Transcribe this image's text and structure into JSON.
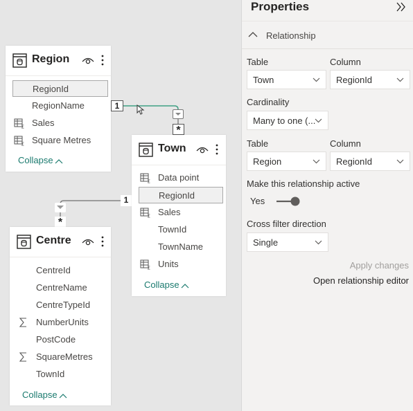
{
  "diagram": {
    "tables": [
      {
        "name": "Region",
        "fields": [
          {
            "label": "RegionId",
            "icon": "none",
            "selected": true
          },
          {
            "label": "RegionName",
            "icon": "none",
            "selected": false
          },
          {
            "label": "Sales",
            "icon": "measure-table-icon",
            "selected": false
          },
          {
            "label": "Square Metres",
            "icon": "measure-table-icon",
            "selected": false
          }
        ],
        "collapse_label": "Collapse"
      },
      {
        "name": "Town",
        "fields": [
          {
            "label": "Data point",
            "icon": "measure-table-icon",
            "selected": false
          },
          {
            "label": "RegionId",
            "icon": "none",
            "selected": true
          },
          {
            "label": "Sales",
            "icon": "measure-table-icon",
            "selected": false
          },
          {
            "label": "TownId",
            "icon": "none",
            "selected": false
          },
          {
            "label": "TownName",
            "icon": "none",
            "selected": false
          },
          {
            "label": "Units",
            "icon": "measure-table-icon",
            "selected": false
          }
        ],
        "collapse_label": "Collapse"
      },
      {
        "name": "Centre",
        "fields": [
          {
            "label": "CentreId",
            "icon": "none",
            "selected": false
          },
          {
            "label": "CentreName",
            "icon": "none",
            "selected": false
          },
          {
            "label": "CentreTypeId",
            "icon": "none",
            "selected": false
          },
          {
            "label": "NumberUnits",
            "icon": "sigma-icon",
            "selected": false
          },
          {
            "label": "PostCode",
            "icon": "none",
            "selected": false
          },
          {
            "label": "SquareMetres",
            "icon": "sigma-icon",
            "selected": false
          },
          {
            "label": "TownId",
            "icon": "none",
            "selected": false
          }
        ],
        "collapse_label": "Collapse"
      }
    ],
    "relationships": [
      {
        "from": "Town",
        "to": "Region",
        "one_label": "1",
        "many_label": "*",
        "highlighted": true,
        "color": "#3fa083"
      },
      {
        "from": "Centre",
        "to": "Town",
        "one_label": "1",
        "many_label": "*",
        "highlighted": false,
        "color": "#707070"
      }
    ]
  },
  "properties": {
    "title": "Properties",
    "section_label": "Relationship",
    "table1": {
      "label": "Table",
      "value": "Town"
    },
    "column1": {
      "label": "Column",
      "value": "RegionId"
    },
    "cardinality": {
      "label": "Cardinality",
      "value": "Many to one (..."
    },
    "table2": {
      "label": "Table",
      "value": "Region"
    },
    "column2": {
      "label": "Column",
      "value": "RegionId"
    },
    "active": {
      "label": "Make this relationship active",
      "value_label": "Yes",
      "on": true
    },
    "cross_filter": {
      "label": "Cross filter direction",
      "value": "Single"
    },
    "apply_label": "Apply changes",
    "editor_label": "Open relationship editor"
  }
}
